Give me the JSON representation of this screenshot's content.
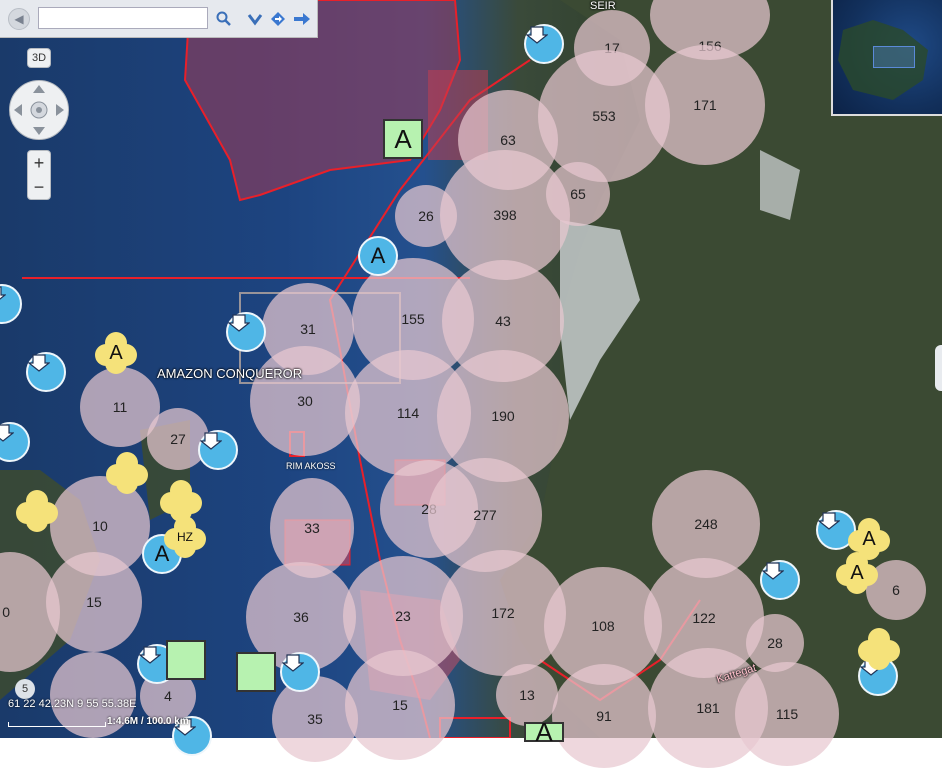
{
  "toolbar": {
    "search_value": "",
    "search_placeholder": "",
    "icons": [
      "back-icon",
      "search-icon",
      "chevron-down-icon",
      "route-icon",
      "direction-icon"
    ]
  },
  "nav": {
    "btn_3d": "3D",
    "zoom_in": "+",
    "zoom_out": "−",
    "level": "5"
  },
  "status": {
    "coords": "61 22 42.23N 9 55 55.38E",
    "scale": "1:4.6M / 100.0 km"
  },
  "labels": {
    "vessel_name": "AMAZON CONQUEROR",
    "place_seir": "SEIR",
    "place_kattegat": "Kattegat",
    "place_harbour": "RIM AKOSS"
  },
  "clusters": [
    {
      "n": "17"
    },
    {
      "n": "156"
    },
    {
      "n": "171"
    },
    {
      "n": "553"
    },
    {
      "n": "63"
    },
    {
      "n": "65"
    },
    {
      "n": "26"
    },
    {
      "n": "398"
    },
    {
      "n": "31"
    },
    {
      "n": "155"
    },
    {
      "n": "43"
    },
    {
      "n": "11"
    },
    {
      "n": "30"
    },
    {
      "n": "114"
    },
    {
      "n": "190"
    },
    {
      "n": "27"
    },
    {
      "n": "28"
    },
    {
      "n": "277"
    },
    {
      "n": "248"
    },
    {
      "n": "10"
    },
    {
      "n": "33"
    },
    {
      "n": "6"
    },
    {
      "n": "15"
    },
    {
      "n": "36"
    },
    {
      "n": "23"
    },
    {
      "n": "172"
    },
    {
      "n": "108"
    },
    {
      "n": "122"
    },
    {
      "n": "28"
    },
    {
      "n": "0"
    },
    {
      "n": "4"
    },
    {
      "n": "35"
    },
    {
      "n": "15"
    },
    {
      "n": "13"
    },
    {
      "n": "91"
    },
    {
      "n": "181"
    },
    {
      "n": "115"
    }
  ],
  "marker_letters": {
    "a": "A",
    "hz": "HZ"
  },
  "colors": {
    "cluster": "#e8c8d0",
    "ship": "#4fb6e6",
    "aton": "#f5e27a",
    "boundary": "#e8202a"
  }
}
